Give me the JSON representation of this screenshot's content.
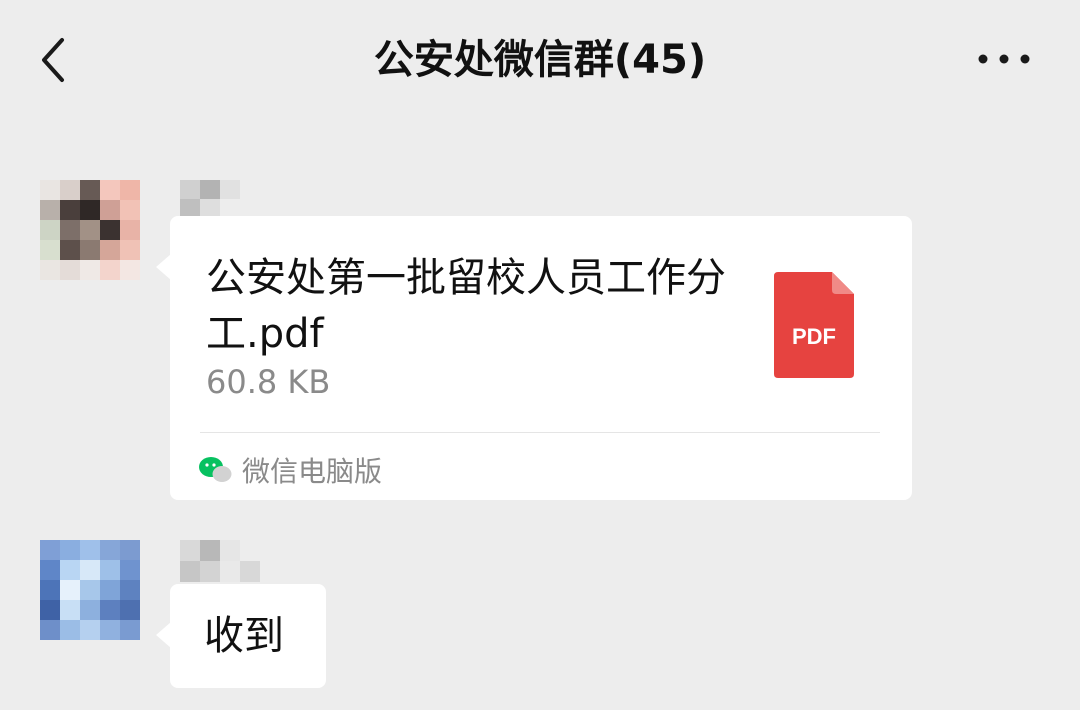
{
  "header": {
    "title": "公安处微信群(45)",
    "back_icon": "chevron-left-icon",
    "more_icon": "more-dots-icon"
  },
  "messages": [
    {
      "type": "file",
      "file_name": "公安处第一批留校人员工作分工.pdf",
      "file_size": "60.8 KB",
      "file_icon_label": "PDF",
      "file_icon_color": "#e64340",
      "source_icon": "wechat-icon",
      "source_label": "微信电脑版"
    },
    {
      "type": "text",
      "text": "收到"
    }
  ],
  "colors": {
    "background": "#ededed",
    "bubble": "#ffffff",
    "pdf_red": "#e64340",
    "wechat_green": "#07c160",
    "secondary_text": "#8a8a8a"
  }
}
